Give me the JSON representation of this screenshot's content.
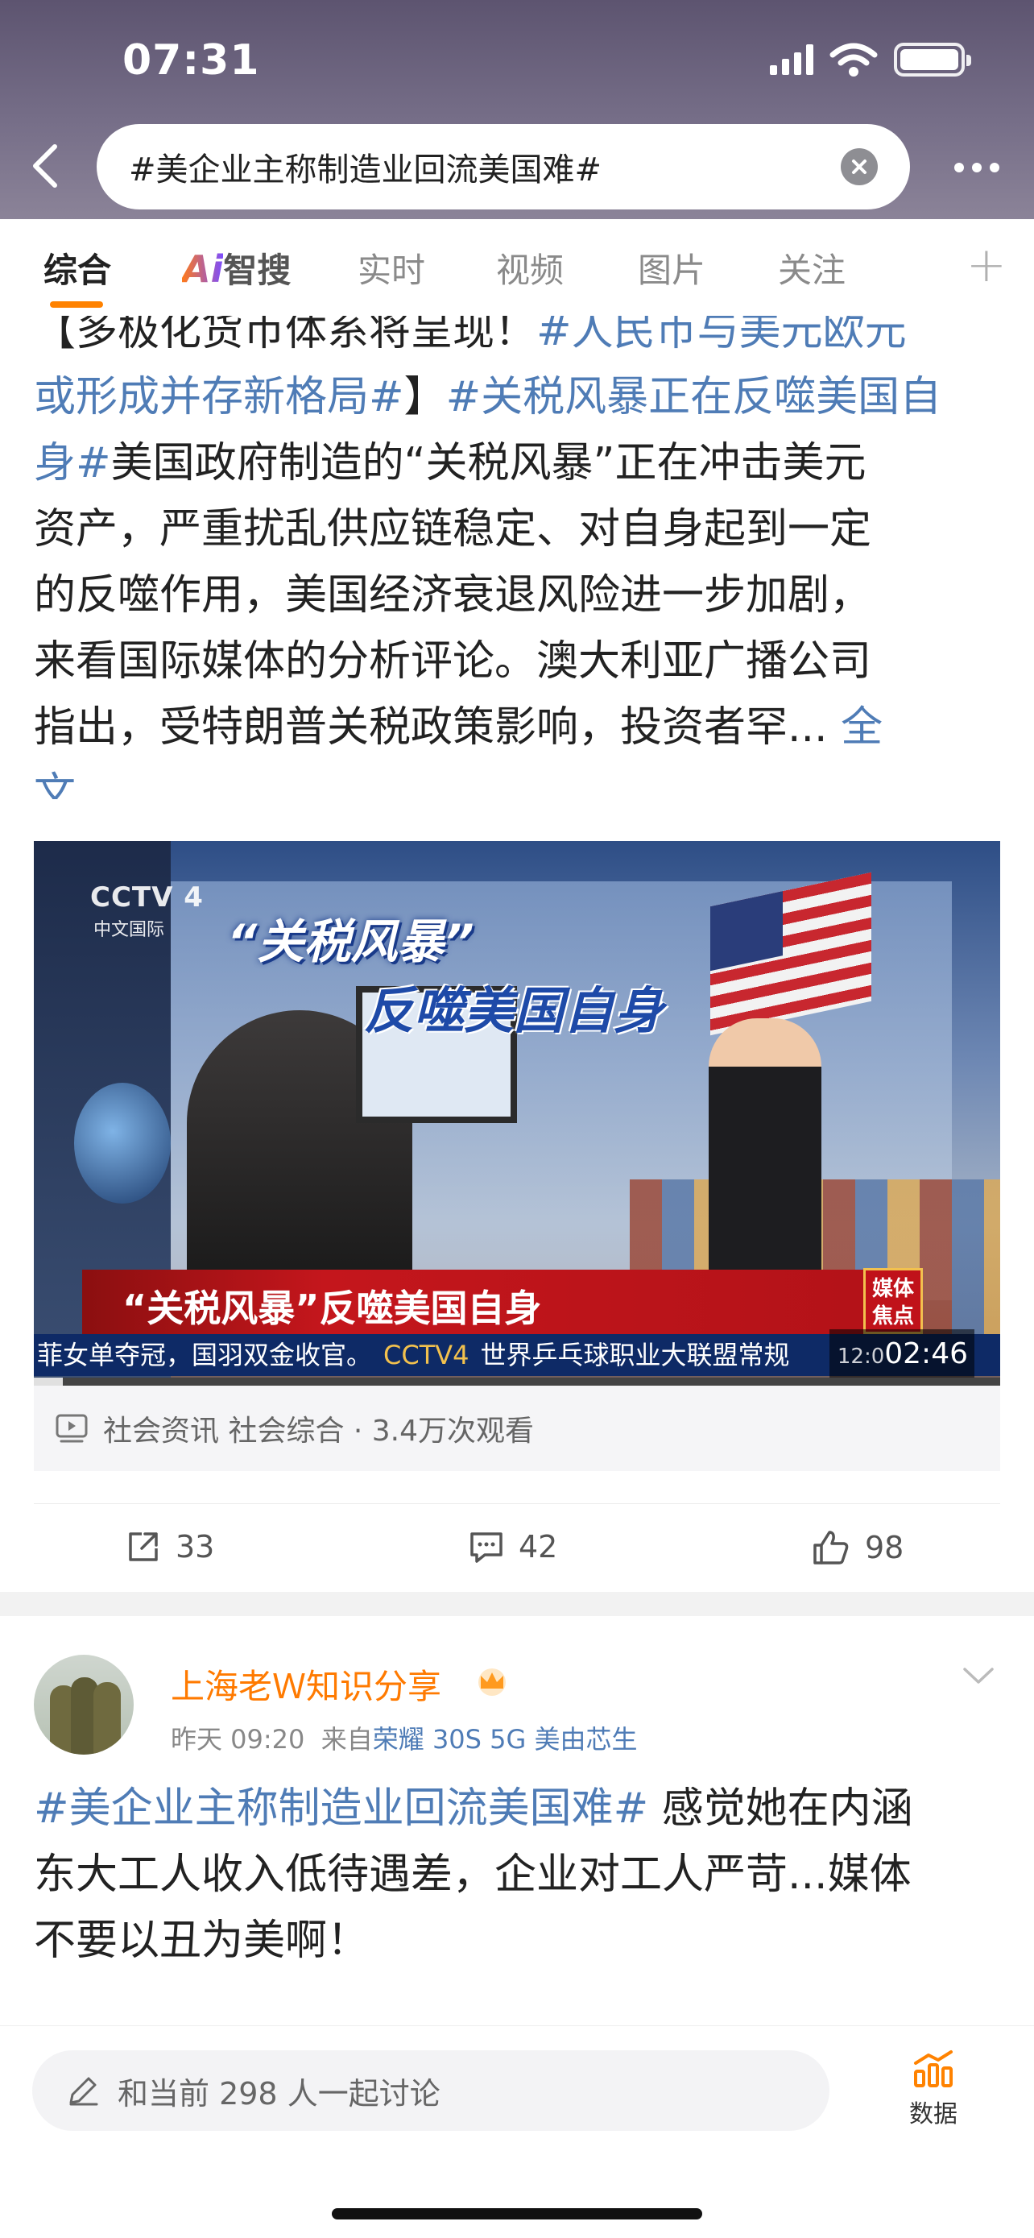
{
  "status": {
    "time": "07:31"
  },
  "search": {
    "query": "#美企业主称制造业回流美国难#"
  },
  "tabs": [
    "综合",
    "智搜",
    "实时",
    "视频",
    "图片",
    "关注"
  ],
  "tab_ai_prefix": "Ai",
  "post1": {
    "lines": [
      {
        "parts": [
          {
            "t": "【多极化货币体系将呈现！",
            "h": false
          },
          {
            "t": "#人民币与美元欧元",
            "h": true
          }
        ]
      },
      {
        "parts": [
          {
            "t": "或形成并存新格局#",
            "h": true
          },
          {
            "t": "】",
            "h": false
          },
          {
            "t": "#关税风暴正在反噬美国自",
            "h": true
          }
        ]
      },
      {
        "parts": [
          {
            "t": "身#",
            "h": true
          },
          {
            "t": "美国政府制造的“关税风暴”正在冲击美元",
            "h": false
          }
        ]
      },
      {
        "parts": [
          {
            "t": "资产，严重扰乱供应链稳定、对自身起到一定",
            "h": false
          }
        ]
      },
      {
        "parts": [
          {
            "t": "的反噬作用，美国经济衰退风险进一步加剧，",
            "h": false
          }
        ]
      },
      {
        "parts": [
          {
            "t": "来看国际媒体的分析评论。澳大利亚广播公司",
            "h": false
          }
        ]
      },
      {
        "parts": [
          {
            "t": "指出，受特朗普关税政策影响，投资者罕...",
            "h": false
          },
          {
            "t": " 全",
            "h": true
          }
        ]
      },
      {
        "parts": [
          {
            "t": "文",
            "h": true
          }
        ]
      }
    ]
  },
  "video": {
    "channel_logo": "CCTV 4",
    "channel_sub": "中文国际",
    "title_line1": "“关税风暴”",
    "title_line2": "反噬美国自身",
    "banner_text": "“关税风暴”反噬美国自身",
    "badge_text": "媒体焦点",
    "ticker_left": "菲女单夺冠，国羽双金收官。",
    "ticker_logo": "CCTV4",
    "ticker_right": "世界乒乓球职业大联盟常规",
    "clock": "12:0",
    "duration": "02:46",
    "progress": 0.03
  },
  "video_meta": {
    "text": "社会资讯 社会综合 · 3.4万次观看"
  },
  "actions": {
    "repost": "33",
    "comment": "42",
    "like": "98"
  },
  "post2": {
    "user": "上海老Ｗ知识分享",
    "time": "昨天 09:20",
    "from_prefix": "来自",
    "device": "荣耀 30S 5G 美由芯生",
    "lines": [
      {
        "parts": [
          {
            "t": "#美企业主称制造业回流美国难#",
            "h": true
          },
          {
            "t": " 感觉她在内涵",
            "h": false
          }
        ]
      },
      {
        "parts": [
          {
            "t": "东大工人收入低待遇差，企业对工人严苛...媒体",
            "h": false
          }
        ]
      },
      {
        "parts": [
          {
            "t": "不要以丑为美啊！",
            "h": false
          }
        ]
      }
    ]
  },
  "bottom": {
    "comment_placeholder": "和当前 298 人一起讨论",
    "data_label": "数据"
  },
  "colors": {
    "accent": "#ff8200",
    "link": "#4f7cb6",
    "username": "#ff7a00"
  }
}
